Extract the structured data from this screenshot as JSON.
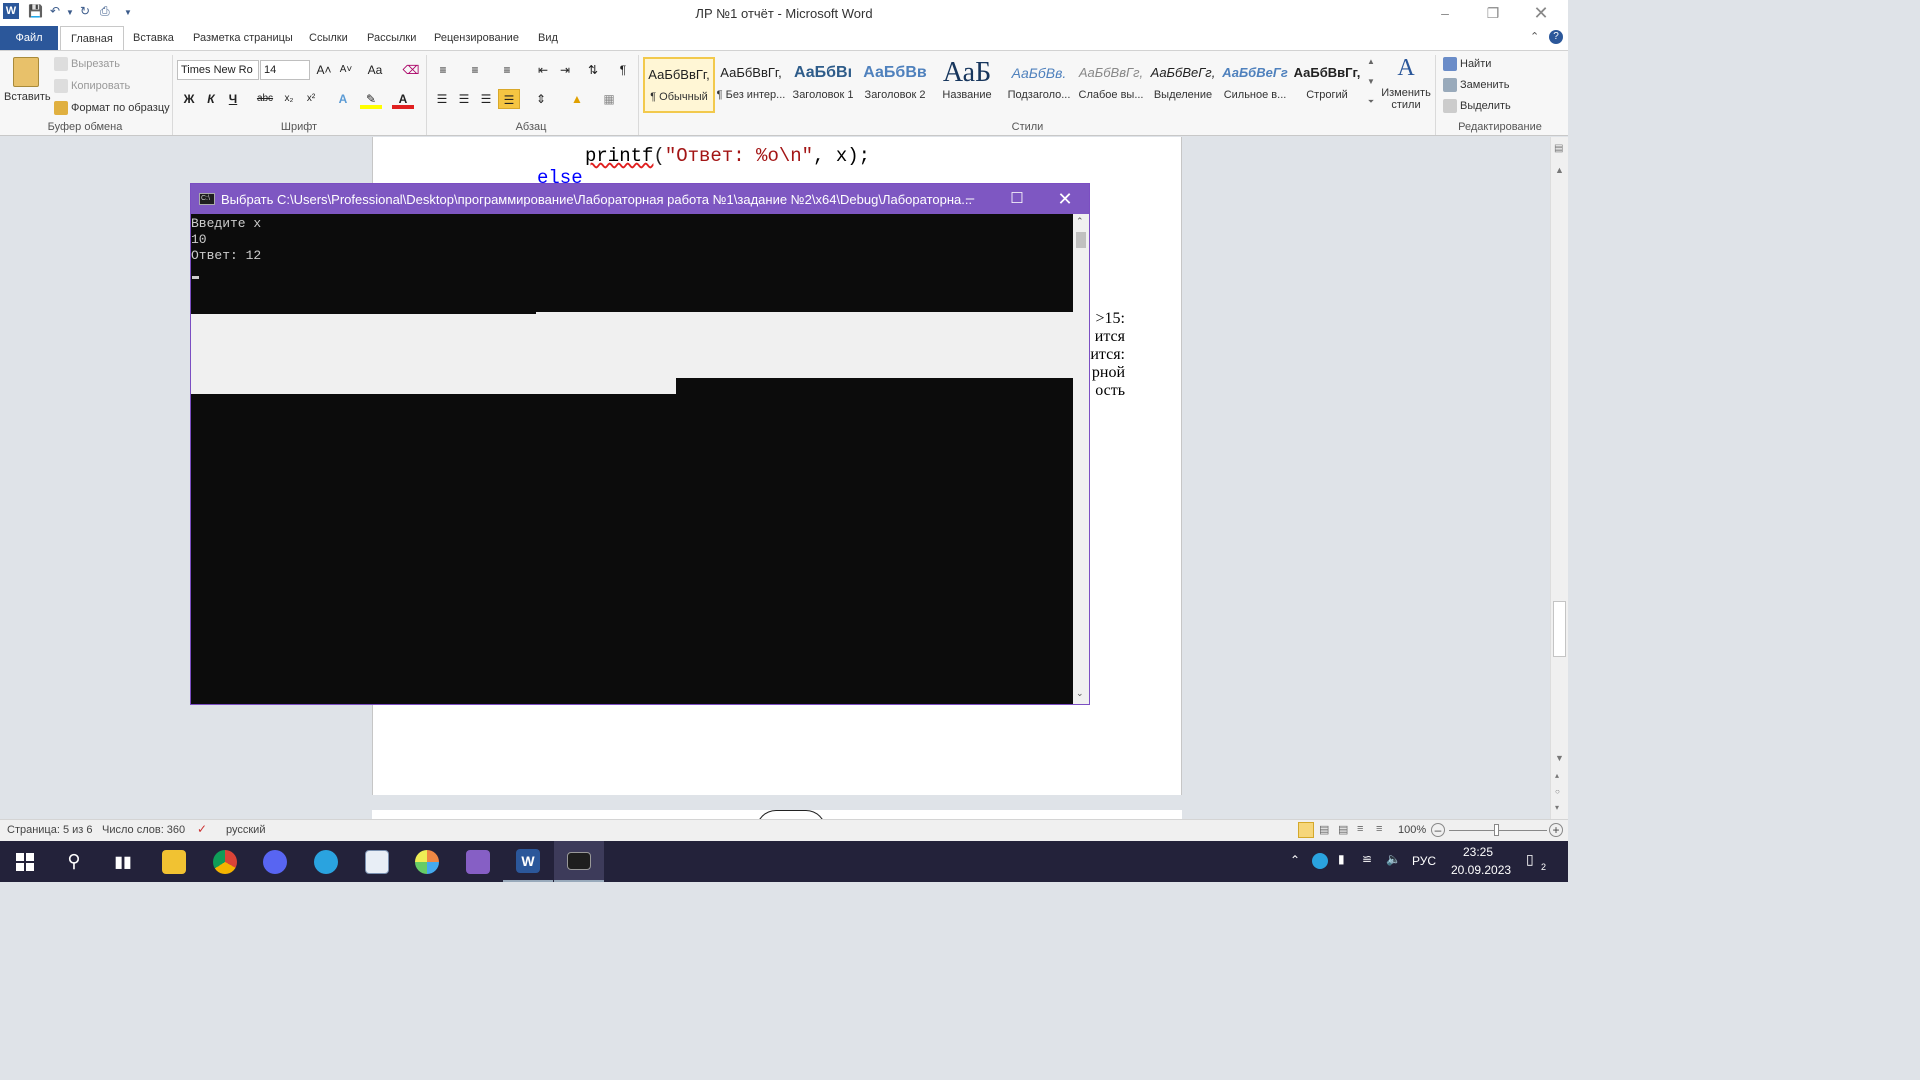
{
  "window": {
    "title": "ЛР №1 отчёт  -  Microsoft Word"
  },
  "tabs": [
    {
      "label": "Файл"
    },
    {
      "label": "Главная"
    },
    {
      "label": "Вставка"
    },
    {
      "label": "Разметка страницы"
    },
    {
      "label": "Ссылки"
    },
    {
      "label": "Рассылки"
    },
    {
      "label": "Рецензирование"
    },
    {
      "label": "Вид"
    }
  ],
  "ribbon": {
    "clipboard": {
      "paste": "Вставить",
      "cut": "Вырезать",
      "copy": "Копировать",
      "format_painter": "Формат по образцу",
      "group": "Буфер обмена"
    },
    "font": {
      "family": "Times New Ro",
      "size": "14",
      "group": "Шрифт",
      "case_btn": "Aa",
      "bold": "Ж",
      "italic": "К",
      "underline": "Ч",
      "strike": "abc",
      "sub": "x₂",
      "sup": "x²"
    },
    "paragraph": {
      "group": "Абзац",
      "pilcrow": "¶"
    },
    "styles": {
      "group": "Стили",
      "items": [
        {
          "sample": "АаБбВвГг,",
          "name": "¶ Обычный"
        },
        {
          "sample": "АаБбВвГг,",
          "name": "¶ Без интер..."
        },
        {
          "sample": "АаБбВı",
          "name": "Заголовок 1"
        },
        {
          "sample": "АаБбВв",
          "name": "Заголовок 2"
        },
        {
          "sample": "АаБ",
          "name": "Название"
        },
        {
          "sample": "АаБбВв.",
          "name": "Подзаголо..."
        },
        {
          "sample": "АаБбВвГг,",
          "name": "Слабое вы..."
        },
        {
          "sample": "АаБбВеГг,",
          "name": "Выделение"
        },
        {
          "sample": "АаБбВеГг",
          "name": "Сильное в..."
        },
        {
          "sample": "АаБбВвГг,",
          "name": "Строгий"
        }
      ],
      "change": "Изменить стили"
    },
    "editing": {
      "group": "Редактирование",
      "find": "Найти",
      "replace": "Заменить",
      "select": "Выделить"
    }
  },
  "document": {
    "code_line1": "printf(\"Ответ: %o\\n\", x);",
    "code_line1_fn": "printf",
    "code_line1_str": "\"Ответ: %o\\n\"",
    "code_line1_rest": ", x);",
    "code_line2": "else",
    "right_text": [
      ">15:",
      "ится",
      "ится:",
      "рной",
      "ость"
    ]
  },
  "console": {
    "title": "Выбрать C:\\Users\\Professional\\Desktop\\программирование\\Лабораторная работа №1\\задание №2\\x64\\Debug\\Лабораторна...",
    "lines": [
      "Введите x",
      "10",
      "Ответ: 12"
    ]
  },
  "statusbar": {
    "page": "Страница: 5 из 6",
    "words": "Число слов: 360",
    "language": "русский",
    "zoom": "100%"
  },
  "taskbar": {
    "lang": "РУС",
    "time": "23:25",
    "date": "20.09.2023",
    "notifications": "2"
  },
  "colors": {
    "word_blue": "#2b579a",
    "console_accent": "#7e57c2",
    "taskbar": "#23223a"
  }
}
